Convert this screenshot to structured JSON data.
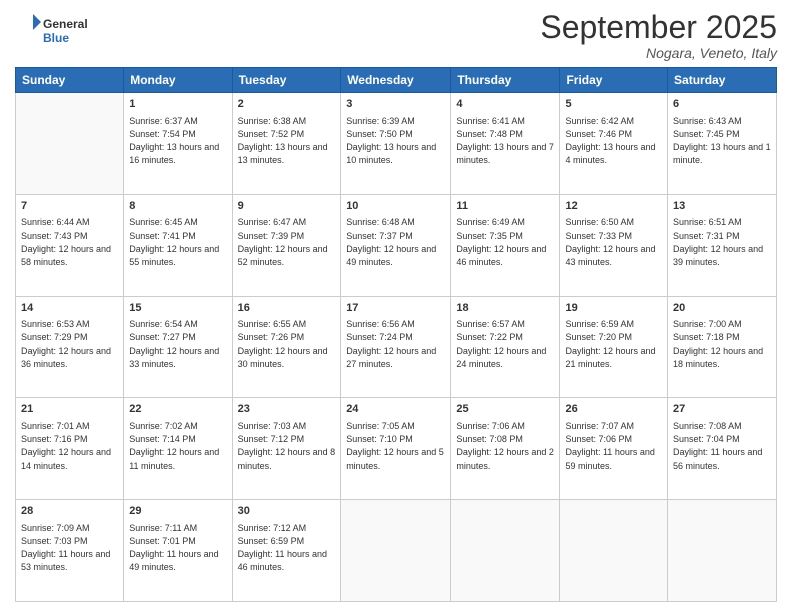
{
  "logo": {
    "general": "General",
    "blue": "Blue"
  },
  "header": {
    "month": "September 2025",
    "location": "Nogara, Veneto, Italy"
  },
  "weekdays": [
    "Sunday",
    "Monday",
    "Tuesday",
    "Wednesday",
    "Thursday",
    "Friday",
    "Saturday"
  ],
  "weeks": [
    [
      {
        "day": "",
        "sunrise": "",
        "sunset": "",
        "daylight": ""
      },
      {
        "day": "1",
        "sunrise": "Sunrise: 6:37 AM",
        "sunset": "Sunset: 7:54 PM",
        "daylight": "Daylight: 13 hours and 16 minutes."
      },
      {
        "day": "2",
        "sunrise": "Sunrise: 6:38 AM",
        "sunset": "Sunset: 7:52 PM",
        "daylight": "Daylight: 13 hours and 13 minutes."
      },
      {
        "day": "3",
        "sunrise": "Sunrise: 6:39 AM",
        "sunset": "Sunset: 7:50 PM",
        "daylight": "Daylight: 13 hours and 10 minutes."
      },
      {
        "day": "4",
        "sunrise": "Sunrise: 6:41 AM",
        "sunset": "Sunset: 7:48 PM",
        "daylight": "Daylight: 13 hours and 7 minutes."
      },
      {
        "day": "5",
        "sunrise": "Sunrise: 6:42 AM",
        "sunset": "Sunset: 7:46 PM",
        "daylight": "Daylight: 13 hours and 4 minutes."
      },
      {
        "day": "6",
        "sunrise": "Sunrise: 6:43 AM",
        "sunset": "Sunset: 7:45 PM",
        "daylight": "Daylight: 13 hours and 1 minute."
      }
    ],
    [
      {
        "day": "7",
        "sunrise": "Sunrise: 6:44 AM",
        "sunset": "Sunset: 7:43 PM",
        "daylight": "Daylight: 12 hours and 58 minutes."
      },
      {
        "day": "8",
        "sunrise": "Sunrise: 6:45 AM",
        "sunset": "Sunset: 7:41 PM",
        "daylight": "Daylight: 12 hours and 55 minutes."
      },
      {
        "day": "9",
        "sunrise": "Sunrise: 6:47 AM",
        "sunset": "Sunset: 7:39 PM",
        "daylight": "Daylight: 12 hours and 52 minutes."
      },
      {
        "day": "10",
        "sunrise": "Sunrise: 6:48 AM",
        "sunset": "Sunset: 7:37 PM",
        "daylight": "Daylight: 12 hours and 49 minutes."
      },
      {
        "day": "11",
        "sunrise": "Sunrise: 6:49 AM",
        "sunset": "Sunset: 7:35 PM",
        "daylight": "Daylight: 12 hours and 46 minutes."
      },
      {
        "day": "12",
        "sunrise": "Sunrise: 6:50 AM",
        "sunset": "Sunset: 7:33 PM",
        "daylight": "Daylight: 12 hours and 43 minutes."
      },
      {
        "day": "13",
        "sunrise": "Sunrise: 6:51 AM",
        "sunset": "Sunset: 7:31 PM",
        "daylight": "Daylight: 12 hours and 39 minutes."
      }
    ],
    [
      {
        "day": "14",
        "sunrise": "Sunrise: 6:53 AM",
        "sunset": "Sunset: 7:29 PM",
        "daylight": "Daylight: 12 hours and 36 minutes."
      },
      {
        "day": "15",
        "sunrise": "Sunrise: 6:54 AM",
        "sunset": "Sunset: 7:27 PM",
        "daylight": "Daylight: 12 hours and 33 minutes."
      },
      {
        "day": "16",
        "sunrise": "Sunrise: 6:55 AM",
        "sunset": "Sunset: 7:26 PM",
        "daylight": "Daylight: 12 hours and 30 minutes."
      },
      {
        "day": "17",
        "sunrise": "Sunrise: 6:56 AM",
        "sunset": "Sunset: 7:24 PM",
        "daylight": "Daylight: 12 hours and 27 minutes."
      },
      {
        "day": "18",
        "sunrise": "Sunrise: 6:57 AM",
        "sunset": "Sunset: 7:22 PM",
        "daylight": "Daylight: 12 hours and 24 minutes."
      },
      {
        "day": "19",
        "sunrise": "Sunrise: 6:59 AM",
        "sunset": "Sunset: 7:20 PM",
        "daylight": "Daylight: 12 hours and 21 minutes."
      },
      {
        "day": "20",
        "sunrise": "Sunrise: 7:00 AM",
        "sunset": "Sunset: 7:18 PM",
        "daylight": "Daylight: 12 hours and 18 minutes."
      }
    ],
    [
      {
        "day": "21",
        "sunrise": "Sunrise: 7:01 AM",
        "sunset": "Sunset: 7:16 PM",
        "daylight": "Daylight: 12 hours and 14 minutes."
      },
      {
        "day": "22",
        "sunrise": "Sunrise: 7:02 AM",
        "sunset": "Sunset: 7:14 PM",
        "daylight": "Daylight: 12 hours and 11 minutes."
      },
      {
        "day": "23",
        "sunrise": "Sunrise: 7:03 AM",
        "sunset": "Sunset: 7:12 PM",
        "daylight": "Daylight: 12 hours and 8 minutes."
      },
      {
        "day": "24",
        "sunrise": "Sunrise: 7:05 AM",
        "sunset": "Sunset: 7:10 PM",
        "daylight": "Daylight: 12 hours and 5 minutes."
      },
      {
        "day": "25",
        "sunrise": "Sunrise: 7:06 AM",
        "sunset": "Sunset: 7:08 PM",
        "daylight": "Daylight: 12 hours and 2 minutes."
      },
      {
        "day": "26",
        "sunrise": "Sunrise: 7:07 AM",
        "sunset": "Sunset: 7:06 PM",
        "daylight": "Daylight: 11 hours and 59 minutes."
      },
      {
        "day": "27",
        "sunrise": "Sunrise: 7:08 AM",
        "sunset": "Sunset: 7:04 PM",
        "daylight": "Daylight: 11 hours and 56 minutes."
      }
    ],
    [
      {
        "day": "28",
        "sunrise": "Sunrise: 7:09 AM",
        "sunset": "Sunset: 7:03 PM",
        "daylight": "Daylight: 11 hours and 53 minutes."
      },
      {
        "day": "29",
        "sunrise": "Sunrise: 7:11 AM",
        "sunset": "Sunset: 7:01 PM",
        "daylight": "Daylight: 11 hours and 49 minutes."
      },
      {
        "day": "30",
        "sunrise": "Sunrise: 7:12 AM",
        "sunset": "Sunset: 6:59 PM",
        "daylight": "Daylight: 11 hours and 46 minutes."
      },
      {
        "day": "",
        "sunrise": "",
        "sunset": "",
        "daylight": ""
      },
      {
        "day": "",
        "sunrise": "",
        "sunset": "",
        "daylight": ""
      },
      {
        "day": "",
        "sunrise": "",
        "sunset": "",
        "daylight": ""
      },
      {
        "day": "",
        "sunrise": "",
        "sunset": "",
        "daylight": ""
      }
    ]
  ]
}
